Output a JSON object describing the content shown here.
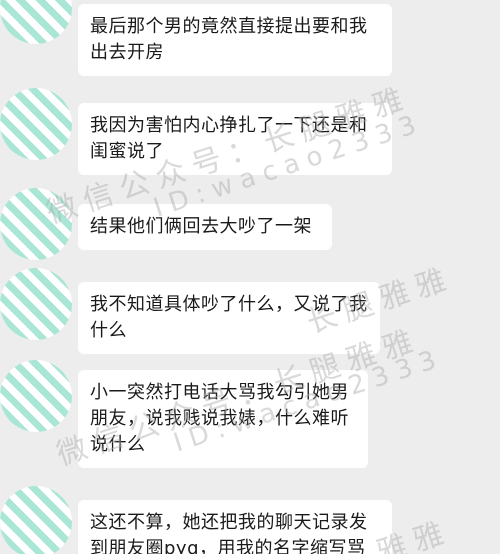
{
  "messages": [
    {
      "text": "最后那个男的竟然直接提出要和我出去开房"
    },
    {
      "text": "我因为害怕内心挣扎了一下还是和闺蜜说了"
    },
    {
      "text": "结果他们俩回去大吵了一架"
    },
    {
      "text": "我不知道具体吵了什么，又说了我什么"
    },
    {
      "text": "小一突然打电话大骂我勾引她男朋友，说我贱说我婊，什么难听说什么"
    },
    {
      "text": "这还不算，她还把我的聊天记录发到朋友圈pyq，用我的名字缩写骂"
    }
  ],
  "watermarks": {
    "line1": "微信公众号：长腿雅雅",
    "line2": "ID:wacao2333",
    "line3": "微信公众号：长腿雅雅",
    "line4": "ID:wacao2333",
    "line5": "长腿雅雅",
    "line6": "雅雅"
  },
  "colors": {
    "background": "#ededed",
    "bubble": "#ffffff",
    "avatar_stripe": "#a9e6d6"
  }
}
